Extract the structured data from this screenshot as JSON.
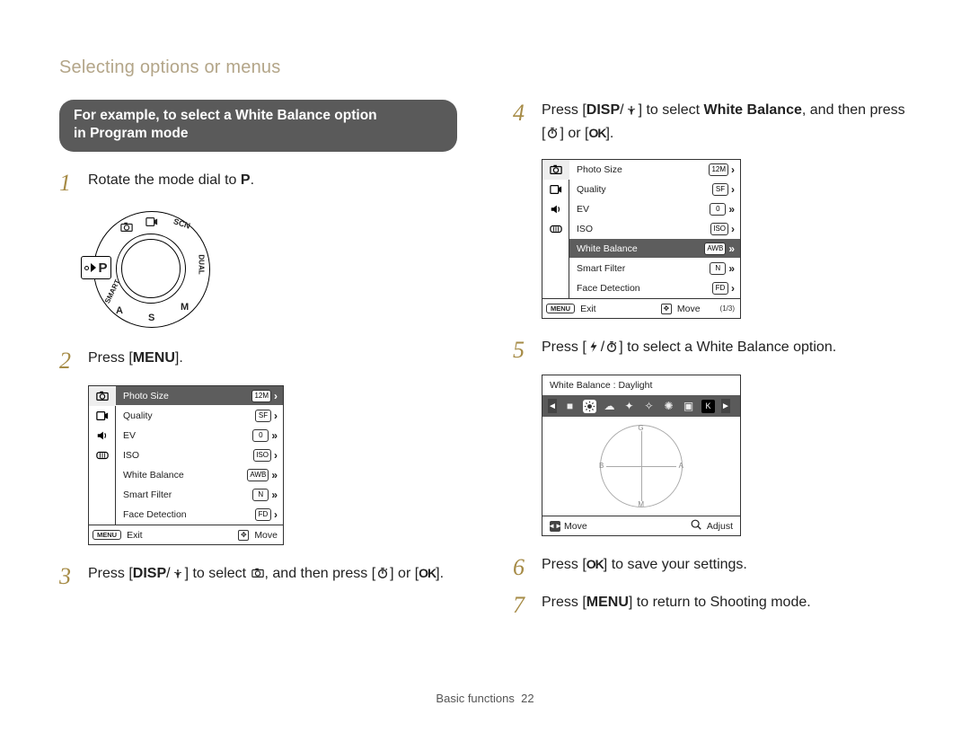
{
  "page_title": "Selecting options or menus",
  "callout": {
    "line1": "For example, to select a White Balance option",
    "line2": "in Program mode"
  },
  "buttons": {
    "menu": "MENU",
    "disp": "DISP",
    "ok": "OK"
  },
  "steps": {
    "s1": {
      "num": "1",
      "pre": "Rotate the mode dial to ",
      "post": "."
    },
    "s2": {
      "num": "2",
      "pre": "Press [",
      "post": "]."
    },
    "s3": {
      "num": "3",
      "a": "Press [",
      "b": "/",
      "c": "] to select ",
      "d": ", and then press [",
      "e": "] or [",
      "f": "]."
    },
    "s4": {
      "num": "4",
      "a": "Press [",
      "b": "/",
      "c": "] to select ",
      "target": "White Balance",
      "d": ", and then press [",
      "e": "] or [",
      "f": "]."
    },
    "s5": {
      "num": "5",
      "a": "Press [",
      "b": "/",
      "c": "] to select a White Balance option."
    },
    "s6": {
      "num": "6",
      "a": "Press [",
      "b": "] to save your settings."
    },
    "s7": {
      "num": "7",
      "a": "Press [",
      "b": "] to return to Shooting mode."
    }
  },
  "menu_panel": {
    "items": [
      {
        "label": "Photo Size",
        "value": "12M",
        "chev": "›"
      },
      {
        "label": "Quality",
        "value": "SF",
        "chev": "›"
      },
      {
        "label": "EV",
        "value": "0",
        "chev": "»"
      },
      {
        "label": "ISO",
        "value": "ISO",
        "chev": "›"
      },
      {
        "label": "White Balance",
        "value": "AWB",
        "chev": "»"
      },
      {
        "label": "Smart Filter",
        "value": "N",
        "chev": "»"
      },
      {
        "label": "Face Detection",
        "value": "FD",
        "chev": "›"
      }
    ],
    "footer": {
      "menu_pill": "MENU",
      "exit": "Exit",
      "move": "Move",
      "pager": "(1/3)"
    }
  },
  "menu_panel_left": {
    "items": [
      {
        "label": "Photo Size",
        "value": "12M",
        "chev": "›"
      },
      {
        "label": "Quality",
        "value": "SF",
        "chev": "›"
      },
      {
        "label": "EV",
        "value": "0",
        "chev": "»"
      },
      {
        "label": "ISO",
        "value": "ISO",
        "chev": "›"
      },
      {
        "label": "White Balance",
        "value": "AWB",
        "chev": "»"
      },
      {
        "label": "Smart Filter",
        "value": "N",
        "chev": "»"
      },
      {
        "label": "Face Detection",
        "value": "FD",
        "chev": "›"
      }
    ],
    "footer": {
      "menu_pill": "MENU",
      "exit": "Exit",
      "move": "Move"
    }
  },
  "wb_screen": {
    "title": "White Balance : Daylight",
    "footer": {
      "move": "Move",
      "adjust": "Adjust"
    },
    "cross": {
      "g": "G",
      "b": "B",
      "a": "A",
      "m": "M"
    }
  },
  "dial": {
    "p": "P",
    "letters": {
      "a": "A",
      "s": "S",
      "m": "M",
      "scn": "SCN",
      "dual": "DUAL",
      "smart": "SMART"
    }
  },
  "footer": {
    "section": "Basic functions",
    "page": "22"
  }
}
